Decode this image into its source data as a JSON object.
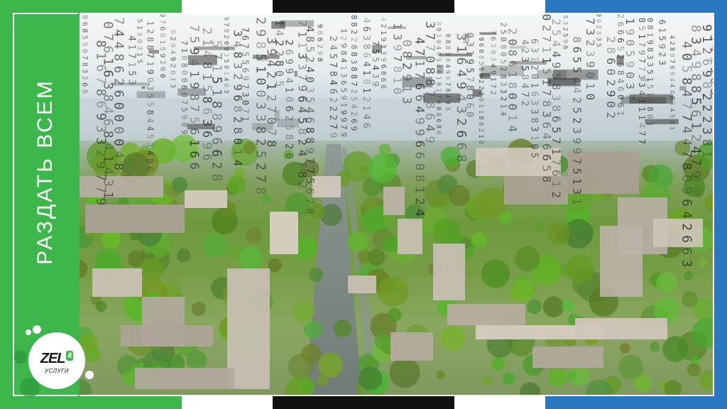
{
  "banner": {
    "title": "РАЗДАТЬ ВСЕМ",
    "colors": {
      "green": "#3db64b",
      "blue": "#2a78c2",
      "black": "#111111",
      "white": "#ffffff"
    }
  },
  "photo": {
    "description_icon": "city-aerial-photo",
    "code_glyphs": [
      "1",
      "8",
      "3",
      "7",
      "4",
      "2",
      "9",
      "0",
      "6",
      "5"
    ]
  },
  "logo": {
    "brand": "ZEL",
    "badge": "it",
    "subtitle": "УСЛУГИ"
  }
}
